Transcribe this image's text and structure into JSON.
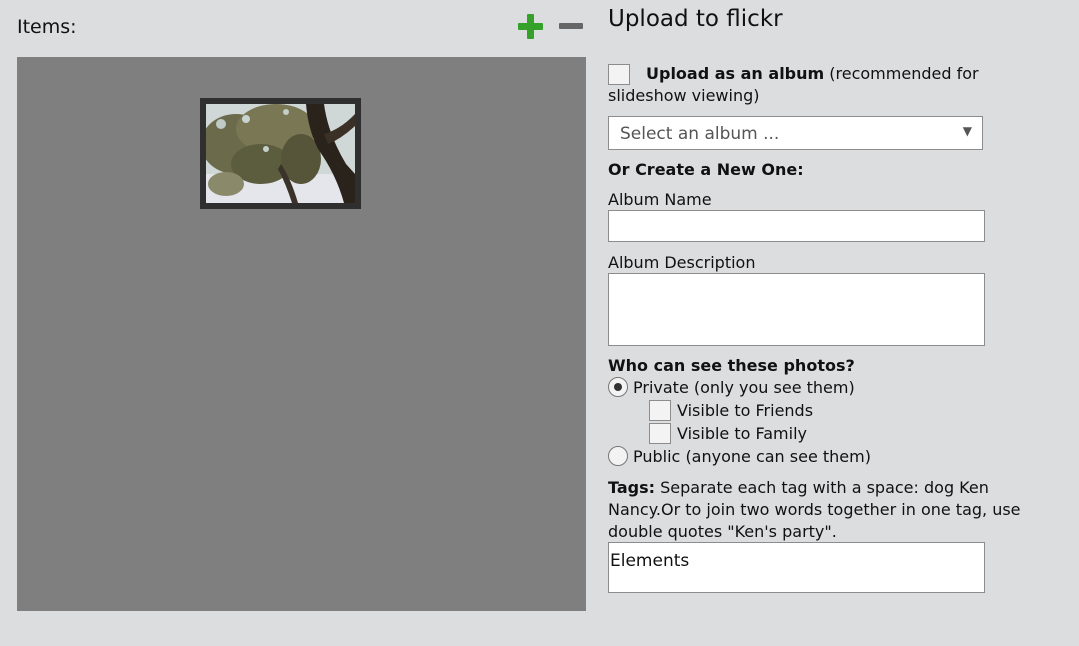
{
  "items": {
    "label": "Items:",
    "add_icon": "plus-icon",
    "remove_icon": "minus-icon",
    "accent_add": "#35a12b"
  },
  "upload": {
    "title": "Upload to flickr",
    "album_checkbox_bold": "Upload as an album",
    "album_checkbox_note": " (recommended for slideshow viewing)",
    "album_checked": false,
    "select_value": "Select an album ...",
    "create_heading": "Or Create a New One:",
    "album_name_label": "Album Name",
    "album_name_value": "",
    "album_desc_label": "Album Description",
    "album_desc_value": "",
    "visibility_heading": "Who can see these photos?",
    "private_label": "Private (only you see them)",
    "private_selected": true,
    "friends_label": "Visible to Friends",
    "family_label": "Visible to Family",
    "public_label": "Public (anyone can see them)",
    "tags_label": "Tags:",
    "tags_help": " Separate each tag with a space: dog Ken Nancy.Or to join two words together in one tag, use double quotes \"Ken's party\".",
    "tags_value": "Elements"
  }
}
